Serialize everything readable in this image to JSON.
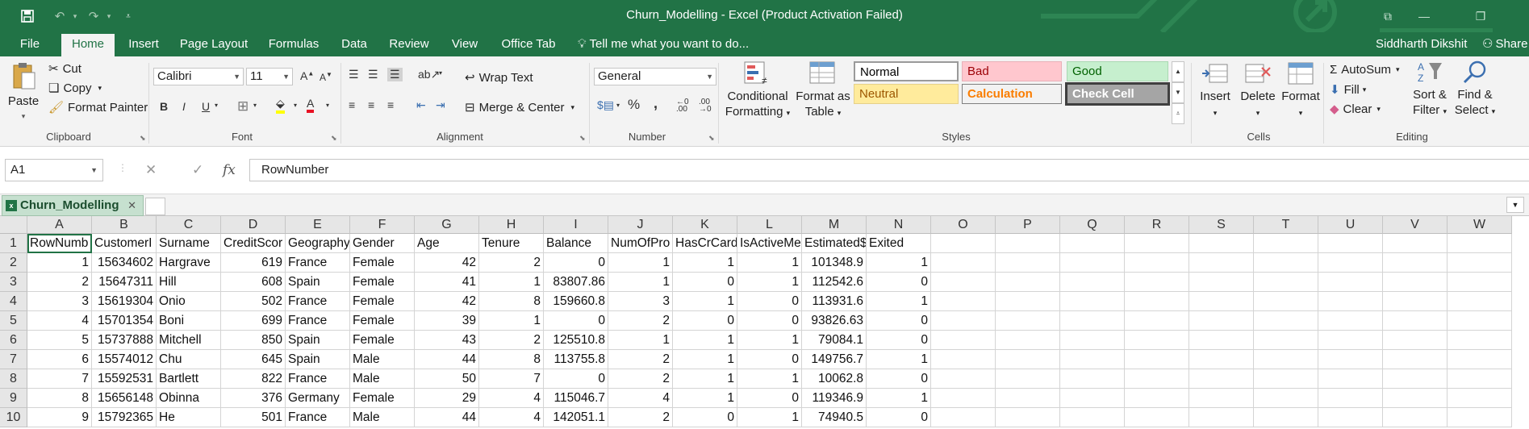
{
  "window": {
    "title": "Churn_Modelling - Excel (Product Activation Failed)",
    "quick_access": {
      "save_icon": "save-icon",
      "undo_icon": "undo-icon",
      "redo_icon": "redo-icon",
      "customize_icon": "customize-qat-icon"
    },
    "controls": {
      "restore_icon": "ribbon-display-icon",
      "minimize_icon": "minimize-icon",
      "maximize_icon": "maximize-icon"
    }
  },
  "menu": {
    "tabs": [
      "File",
      "Home",
      "Insert",
      "Page Layout",
      "Formulas",
      "Data",
      "Review",
      "View",
      "Office Tab"
    ],
    "active_tab": "Home",
    "tell_me": "Tell me what you want to do...",
    "user": "Siddharth Dikshit",
    "share": "Share"
  },
  "ribbon": {
    "clipboard": {
      "label": "Clipboard",
      "paste": "Paste",
      "cut": "Cut",
      "copy": "Copy",
      "format_painter": "Format Painter"
    },
    "font": {
      "label": "Font",
      "name": "Calibri",
      "size": "11",
      "bold": "B",
      "italic": "I",
      "underline": "U"
    },
    "alignment": {
      "label": "Alignment",
      "wrap_text": "Wrap Text",
      "merge_center": "Merge & Center"
    },
    "number": {
      "label": "Number",
      "format": "General",
      "percent": "%",
      "comma": ","
    },
    "styles": {
      "label": "Styles",
      "conditional_formatting": [
        "Conditional",
        "Formatting"
      ],
      "format_as_table": [
        "Format as",
        "Table"
      ],
      "cells": [
        {
          "name": "Normal",
          "bg": "#ffffff",
          "fg": "#000000",
          "border": "#9a9a9a"
        },
        {
          "name": "Bad",
          "bg": "#ffc7ce",
          "fg": "#9c0006",
          "border": "#e8b0b8"
        },
        {
          "name": "Good",
          "bg": "#c6efce",
          "fg": "#006100",
          "border": "#a9d8b2"
        },
        {
          "name": "Neutral",
          "bg": "#ffeb9c",
          "fg": "#9c5700",
          "border": "#e6d08a"
        },
        {
          "name": "Calculation",
          "bg": "#f2f2f2",
          "fg": "#fa7d00",
          "border": "#7f7f7f"
        },
        {
          "name": "Check Cell",
          "bg": "#a5a5a5",
          "fg": "#ffffff",
          "border": "#3f3f3f"
        }
      ]
    },
    "cells": {
      "label": "Cells",
      "insert": "Insert",
      "delete": "Delete",
      "format": "Format"
    },
    "editing": {
      "label": "Editing",
      "autosum": "AutoSum",
      "fill": "Fill",
      "clear": "Clear",
      "sort_filter": [
        "Sort &",
        "Filter"
      ],
      "find_select": [
        "Find &",
        "Select"
      ]
    }
  },
  "formula_bar": {
    "name_box": "A1",
    "fx": "fx",
    "content": "RowNumber"
  },
  "workbook_tab": {
    "name": "Churn_Modelling"
  },
  "sheet": {
    "columns": [
      "A",
      "B",
      "C",
      "D",
      "E",
      "F",
      "G",
      "H",
      "I",
      "J",
      "K",
      "L",
      "M",
      "N",
      "O",
      "P",
      "Q",
      "R",
      "S",
      "T",
      "U",
      "V",
      "W"
    ],
    "row_numbers": [
      "1",
      "2",
      "3",
      "4",
      "5",
      "6",
      "7",
      "8",
      "9",
      "10"
    ],
    "rows": [
      [
        "RowNumb",
        "CustomerI",
        "Surname",
        "CreditScor",
        "Geography",
        "Gender",
        "Age",
        "Tenure",
        "Balance",
        "NumOfPro",
        "HasCrCard",
        "IsActiveMe",
        "Estimated$",
        "Exited"
      ],
      [
        "1",
        "15634602",
        "Hargrave",
        "619",
        "France",
        "Female",
        "42",
        "2",
        "0",
        "1",
        "1",
        "1",
        "101348.9",
        "1"
      ],
      [
        "2",
        "15647311",
        "Hill",
        "608",
        "Spain",
        "Female",
        "41",
        "1",
        "83807.86",
        "1",
        "0",
        "1",
        "112542.6",
        "0"
      ],
      [
        "3",
        "15619304",
        "Onio",
        "502",
        "France",
        "Female",
        "42",
        "8",
        "159660.8",
        "3",
        "1",
        "0",
        "113931.6",
        "1"
      ],
      [
        "4",
        "15701354",
        "Boni",
        "699",
        "France",
        "Female",
        "39",
        "1",
        "0",
        "2",
        "0",
        "0",
        "93826.63",
        "0"
      ],
      [
        "5",
        "15737888",
        "Mitchell",
        "850",
        "Spain",
        "Female",
        "43",
        "2",
        "125510.8",
        "1",
        "1",
        "1",
        "79084.1",
        "0"
      ],
      [
        "6",
        "15574012",
        "Chu",
        "645",
        "Spain",
        "Male",
        "44",
        "8",
        "113755.8",
        "2",
        "1",
        "0",
        "149756.7",
        "1"
      ],
      [
        "7",
        "15592531",
        "Bartlett",
        "822",
        "France",
        "Male",
        "50",
        "7",
        "0",
        "2",
        "1",
        "1",
        "10062.8",
        "0"
      ],
      [
        "8",
        "15656148",
        "Obinna",
        "376",
        "Germany",
        "Female",
        "29",
        "4",
        "115046.7",
        "4",
        "1",
        "0",
        "119346.9",
        "1"
      ],
      [
        "9",
        "15792365",
        "He",
        "501",
        "France",
        "Male",
        "44",
        "4",
        "142051.1",
        "2",
        "0",
        "1",
        "74940.5",
        "0"
      ]
    ]
  }
}
